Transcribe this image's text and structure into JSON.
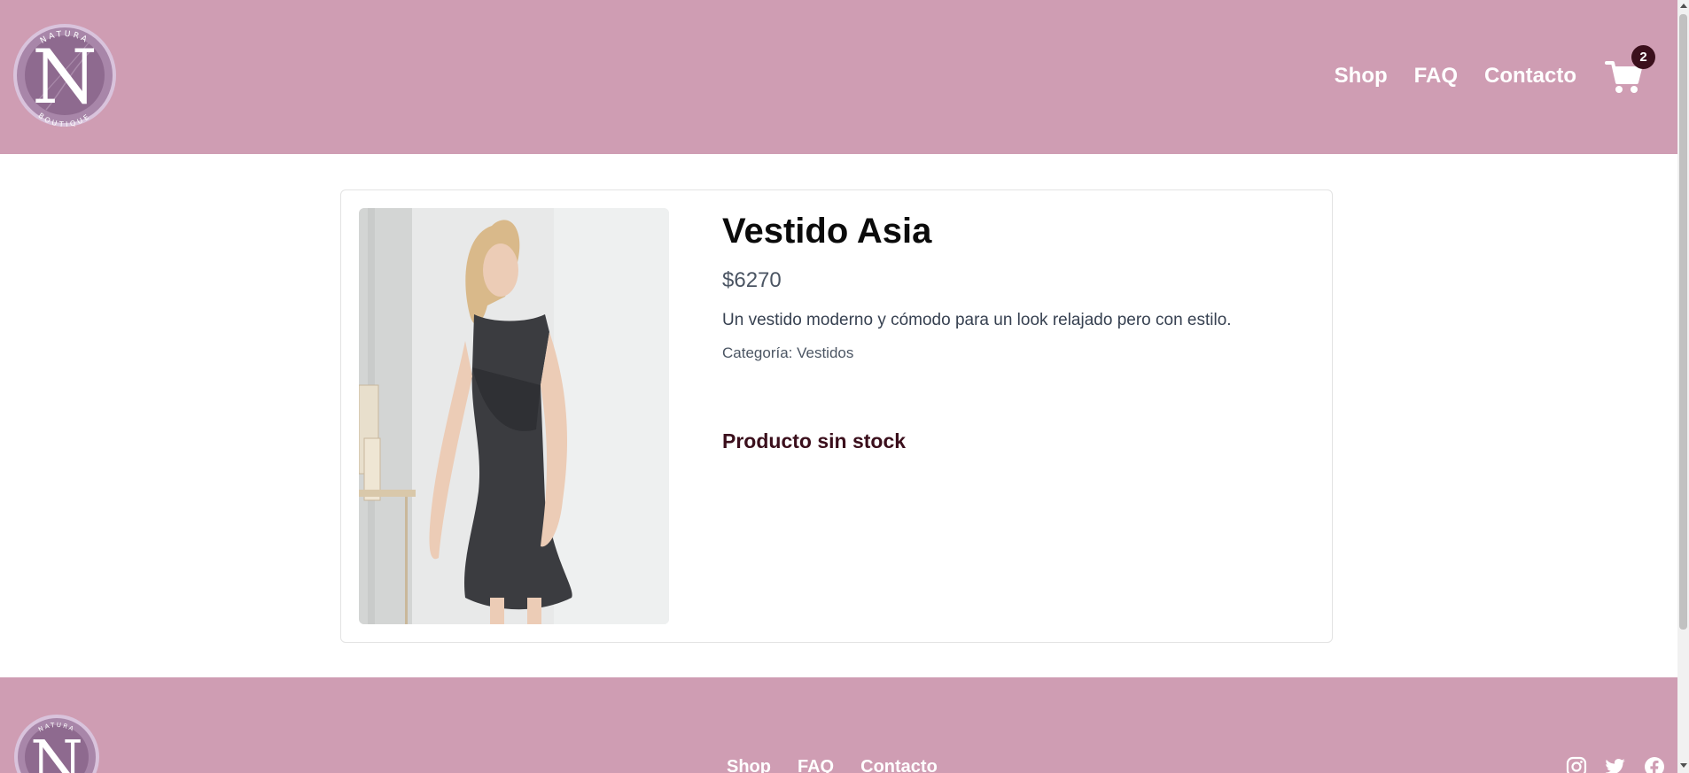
{
  "brand": {
    "logo_text_top": "NATURA",
    "logo_letter": "N",
    "logo_text_bottom": "BOUTIQUE"
  },
  "nav": {
    "items": [
      {
        "label": "Shop"
      },
      {
        "label": "FAQ"
      },
      {
        "label": "Contacto"
      }
    ],
    "cart_count": "2",
    "cart_icon": "cart-icon"
  },
  "product": {
    "title": "Vestido Asia",
    "price": "$6270",
    "description": "Un vestido moderno y cómodo para un look relajado pero con estilo.",
    "category": "Categoría: Vestidos",
    "stock_status": "Producto sin stock"
  },
  "footer": {
    "nav": [
      {
        "label": "Shop"
      },
      {
        "label": "FAQ"
      },
      {
        "label": "Contacto"
      }
    ],
    "social_icons": [
      "instagram-icon",
      "twitter-icon",
      "facebook-icon"
    ]
  },
  "colors": {
    "header_bg": "#cf9db3",
    "badge_bg": "#3b0f1c",
    "logo_circle": "#8e6a8f"
  }
}
